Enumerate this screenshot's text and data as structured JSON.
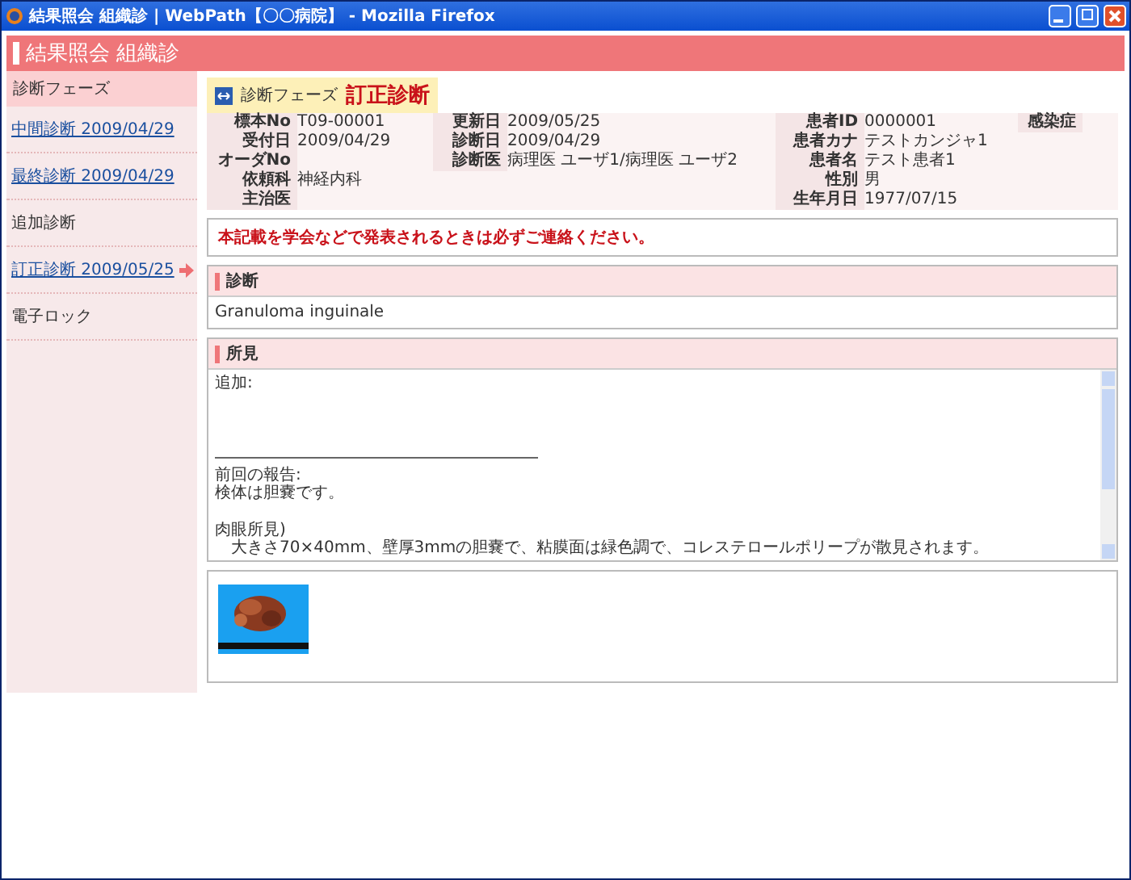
{
  "window": {
    "title": "結果照会 組織診 | WebPath【〇〇病院】 - Mozilla Firefox"
  },
  "page_title": "結果照会 組織診",
  "sidebar": {
    "heading": "診断フェーズ",
    "items": [
      {
        "label": "中間診断 2009/04/29",
        "kind": "link",
        "selected": false
      },
      {
        "label": "最終診断 2009/04/29",
        "kind": "link",
        "selected": false
      },
      {
        "label": "追加診断",
        "kind": "text",
        "selected": false
      },
      {
        "label": "訂正診断 2009/05/25",
        "kind": "link",
        "selected": true
      },
      {
        "label": "電子ロック",
        "kind": "text",
        "selected": false
      }
    ]
  },
  "phase": {
    "label": "診断フェーズ",
    "value": "訂正診断"
  },
  "info": {
    "specimen": [
      {
        "label": "標本No",
        "value": "T09-00001"
      },
      {
        "label": "受付日",
        "value": "2009/04/29"
      },
      {
        "label": "オーダNo"
      },
      {
        "label": "依頼科",
        "value": "神経内科"
      },
      {
        "label": "主治医"
      }
    ],
    "dates": [
      {
        "label": "更新日",
        "value": "2009/05/25"
      },
      {
        "label": "診断日",
        "value": "2009/04/29"
      },
      {
        "label": "診断医",
        "value": "病理医 ユーザ1/病理医 ユーザ2"
      }
    ],
    "patient": [
      {
        "label": "患者ID",
        "value": "0000001"
      },
      {
        "label": "患者カナ",
        "value": "テストカンジャ1"
      },
      {
        "label": "患者名",
        "value": "テスト患者1"
      },
      {
        "label": "性別",
        "value": "男"
      },
      {
        "label": "生年月日",
        "value": "1977/07/15"
      }
    ],
    "infection": {
      "label": "感染症"
    }
  },
  "notice": "本記載を学会などで発表されるときは必ずご連絡ください。",
  "diagnosis": {
    "title": "診断",
    "text": "Granuloma inguinale"
  },
  "findings": {
    "title": "所見",
    "addendum": "追加:",
    "sections": [
      {
        "lines": [
          "前回の報告:",
          "検体は胆嚢です。"
        ]
      },
      {
        "lines": [
          "肉眼所見)",
          "　大きさ70×40mm、壁厚3mmの胆嚢で、粘膜面は緑色調で、コレステロールポリープが散見されます。"
        ]
      }
    ]
  }
}
